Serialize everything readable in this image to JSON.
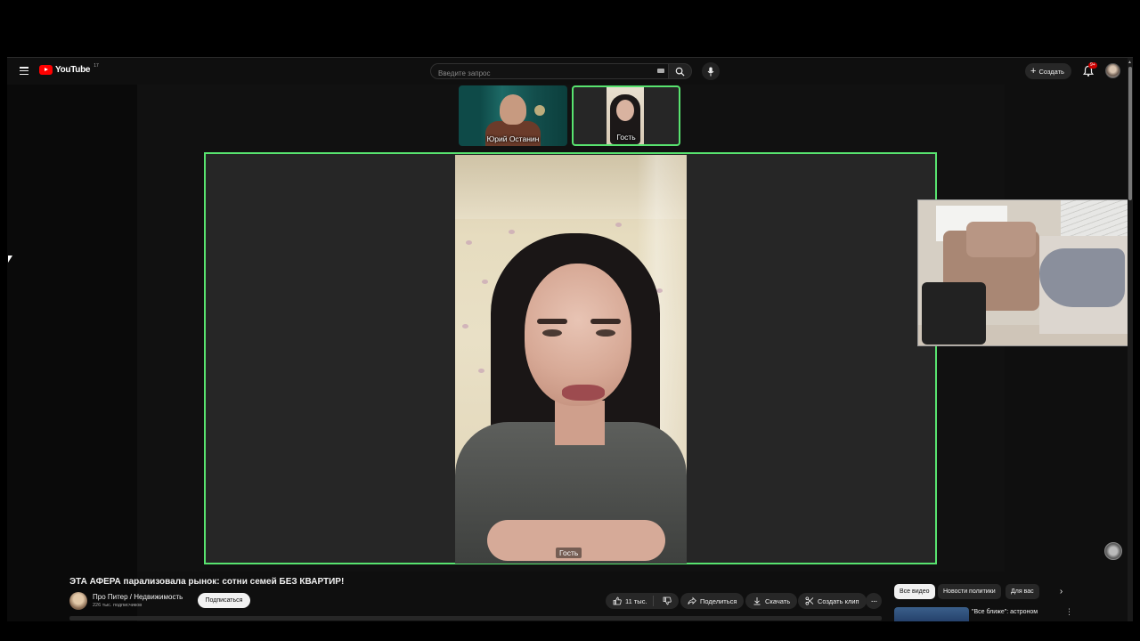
{
  "header": {
    "logo_text": "YouTube",
    "logo_sup": "17",
    "search_placeholder": "Введите запрос",
    "create_label": "Создать",
    "notification_badge": "9+"
  },
  "call": {
    "participants": [
      {
        "label": "Юрий Останин",
        "active": false
      },
      {
        "label": "Гость",
        "active": true
      }
    ],
    "main_label": "Гость",
    "highlight_color": "#58e36f"
  },
  "video": {
    "title": "ЭТА АФЕРА парализовала рынок: сотни семей БЕЗ КВАРТИР!",
    "channel_name": "Про Питер / Недвижимость",
    "subscribers": "226 тыс. подписчиков",
    "subscribe_label": "Подписаться"
  },
  "actions": {
    "likes": "11 тыс.",
    "share": "Поделиться",
    "download": "Скачать",
    "clip": "Создать клип",
    "more": "···"
  },
  "chips": [
    "Все видео",
    "Новости политики",
    "Для вас"
  ],
  "recommendation": {
    "title": "\"Все ближе\": астроном"
  },
  "colors": {
    "background": "#0f0f0f",
    "brand_red": "#ff0000",
    "accent_green": "#58e36f"
  }
}
